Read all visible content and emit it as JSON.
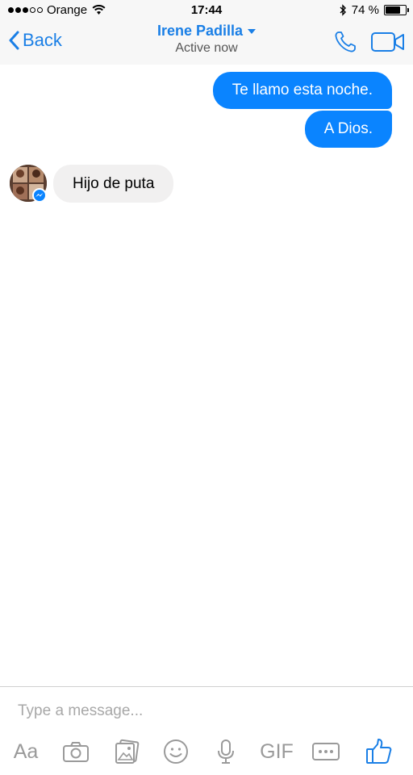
{
  "status_bar": {
    "carrier": "Orange",
    "time": "17:44",
    "battery_percent": "74 %",
    "battery_level": 0.74
  },
  "nav": {
    "back_label": "Back",
    "contact_name": "Irene Padilla",
    "status": "Active now"
  },
  "messages": [
    {
      "direction": "outgoing",
      "text": "Te llamo esta noche."
    },
    {
      "direction": "outgoing",
      "text": "A Dios."
    },
    {
      "direction": "incoming",
      "text": "Hijo de puta"
    }
  ],
  "composer": {
    "placeholder": "Type a message...",
    "tools": {
      "text_format": "Aa",
      "gif": "GIF"
    }
  },
  "colors": {
    "accent": "#1a7fe6",
    "outgoing_bubble": "#0a84ff",
    "incoming_bubble": "#f1f0f0"
  }
}
